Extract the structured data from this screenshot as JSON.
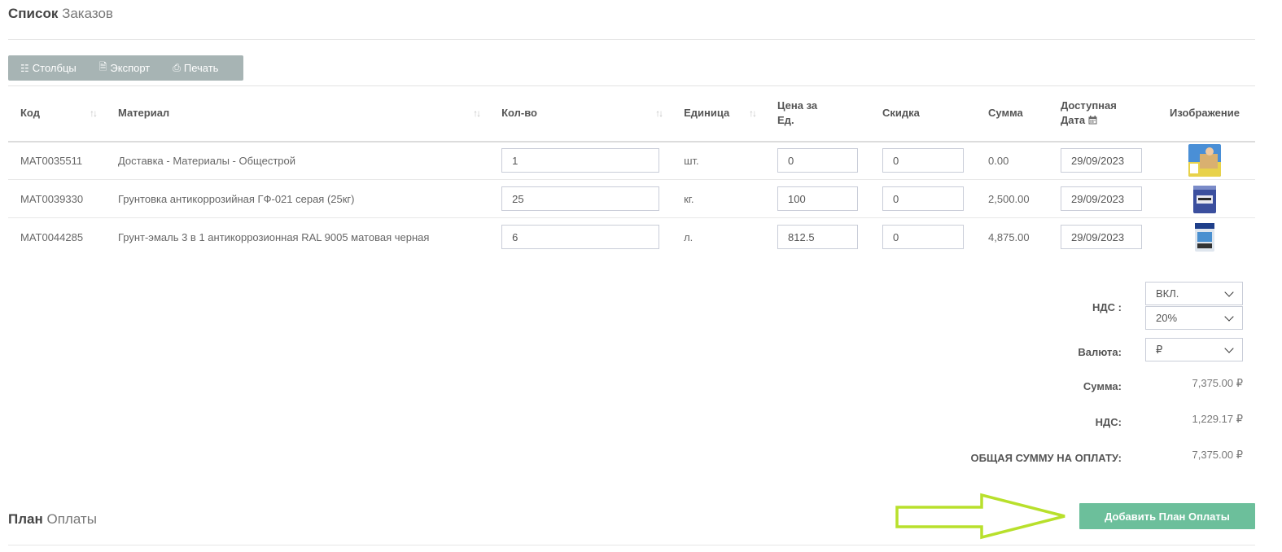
{
  "order_section": {
    "title_bold": "Список",
    "title_rest": "Заказов"
  },
  "toolbar": {
    "columns_label": "Столбцы",
    "export_label": "Экспорт",
    "print_label": "Печать"
  },
  "table": {
    "headers": {
      "code": "Код",
      "material": "Материал",
      "qty": "Кол-во",
      "unit": "Единица",
      "price_line1": "Цена за",
      "price_line2": "Ед.",
      "discount": "Скидка",
      "sum": "Сумма",
      "date_line1": "Доступная",
      "date_line2": "Дата",
      "image": "Изображение"
    },
    "rows": [
      {
        "code": "MAT0035511",
        "material": "Доставка - Материалы - Общестрой",
        "qty": "1",
        "unit": "шт.",
        "price": "0",
        "discount": "0",
        "sum": "0.00",
        "date": "29/09/2023"
      },
      {
        "code": "MAT0039330",
        "material": "Грунтовка антикоррозийная ГФ-021 серая (25кг)",
        "qty": "25",
        "unit": "кг.",
        "price": "100",
        "discount": "0",
        "sum": "2,500.00",
        "date": "29/09/2023"
      },
      {
        "code": "MAT0044285",
        "material": "Грунт-эмаль 3 в 1 антикоррозионная RAL 9005 матовая черная",
        "qty": "6",
        "unit": "л.",
        "price": "812.5",
        "discount": "0",
        "sum": "4,875.00",
        "date": "29/09/2023"
      }
    ]
  },
  "summary": {
    "vat_label": "НДС :",
    "vat_mode": "ВКЛ.",
    "vat_rate": "20%",
    "currency_label": "Валюта:",
    "currency_value": "₽",
    "sum_label": "Сумма:",
    "sum_value": "7,375.00 ₽",
    "vat_amount_label": "НДС:",
    "vat_amount_value": "1,229.17 ₽",
    "total_label": "ОБЩАЯ СУММУ НА ОПЛАТУ:",
    "total_value": "7,375.00 ₽"
  },
  "payment_section": {
    "title_bold": "План",
    "title_rest": "Оплаты",
    "add_button_label": "Добавить План Оплаты"
  },
  "colors": {
    "toolbar_bg": "#a7b4b4",
    "add_button_bg": "#6cbf9b",
    "annotation_arrow": "#b8e02c"
  }
}
